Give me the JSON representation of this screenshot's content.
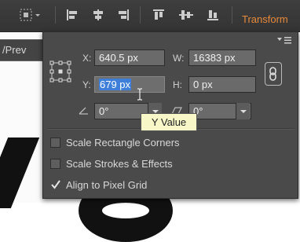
{
  "toolbar": {
    "title": "Transform",
    "icons": [
      "artboard-align-icon",
      "align-left-icon",
      "align-center-icon",
      "align-right-icon",
      "align-top-icon",
      "align-middle-icon",
      "align-bottom-icon"
    ]
  },
  "document": {
    "tab_text": "/Prev"
  },
  "panel": {
    "x": {
      "label": "X:",
      "value": "640.5 px"
    },
    "w": {
      "label": "W:",
      "value": "16383 px"
    },
    "y": {
      "label": "Y:",
      "value": "679 px"
    },
    "h": {
      "label": "H:",
      "value": "0 px"
    },
    "rotate": {
      "value": "0°"
    },
    "shear": {
      "value": "0°"
    },
    "tooltip": "Y Value",
    "options": [
      {
        "label": "Scale Rectangle Corners",
        "checked": false
      },
      {
        "label": "Scale Strokes & Effects",
        "checked": false
      },
      {
        "label": "Align to Pixel Grid",
        "checked": true
      }
    ]
  },
  "colors": {
    "accent": "#e88a3a",
    "selection": "#3d7fd9",
    "tooltip_bg": "#f7f7c8"
  }
}
